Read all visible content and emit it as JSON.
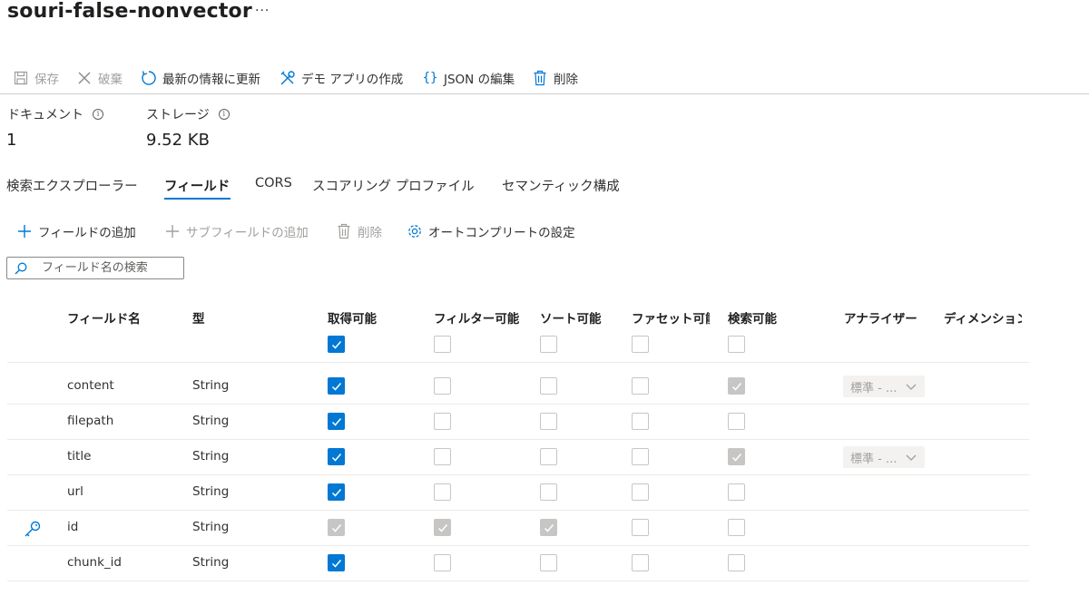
{
  "page": {
    "title": "souri-false-nonvector",
    "more": "···"
  },
  "toolbar": {
    "save": "保存",
    "discard": "破棄",
    "refresh": "最新の情報に更新",
    "demo_app": "デモ アプリの作成",
    "json_edit": "JSON の編集",
    "delete": "削除"
  },
  "stats": {
    "documents_label": "ドキュメント",
    "documents_value": "1",
    "storage_label": "ストレージ",
    "storage_value": "9.52 KB"
  },
  "tabs": [
    "検索エクスプローラー",
    "フィールド",
    "CORS",
    "スコアリング プロファイル",
    "セマンティック構成"
  ],
  "field_toolbar": {
    "add_field": "フィールドの追加",
    "add_subfield": "サブフィールドの追加",
    "delete": "削除",
    "autocomplete": "オートコンプリートの設定"
  },
  "search": {
    "placeholder": "フィールド名の検索"
  },
  "table": {
    "headers": {
      "name": "フィールド名",
      "type": "型",
      "retrievable": "取得可能",
      "filterable": "フィルター可能",
      "sortable": "ソート可能",
      "facetable": "ファセット可能",
      "searchable": "検索可能",
      "analyzer": "アナライザー",
      "dimensions": "ディメンション"
    },
    "header_checks": {
      "retrievable": "on",
      "filterable": "off",
      "sortable": "off",
      "facetable": "off",
      "searchable": "off"
    },
    "rows": [
      {
        "name": "content",
        "type": "String",
        "key": false,
        "retrievable": "on",
        "filterable": "off",
        "sortable": "off",
        "facetable": "off",
        "searchable": "dis",
        "analyzer": "標準 - ..."
      },
      {
        "name": "filepath",
        "type": "String",
        "key": false,
        "retrievable": "on",
        "filterable": "off",
        "sortable": "off",
        "facetable": "off",
        "searchable": "off",
        "analyzer": ""
      },
      {
        "name": "title",
        "type": "String",
        "key": false,
        "retrievable": "on",
        "filterable": "off",
        "sortable": "off",
        "facetable": "off",
        "searchable": "dis",
        "analyzer": "標準 - ..."
      },
      {
        "name": "url",
        "type": "String",
        "key": false,
        "retrievable": "on",
        "filterable": "off",
        "sortable": "off",
        "facetable": "off",
        "searchable": "off",
        "analyzer": ""
      },
      {
        "name": "id",
        "type": "String",
        "key": true,
        "retrievable": "dis",
        "filterable": "dis",
        "sortable": "dis",
        "facetable": "off",
        "searchable": "off",
        "analyzer": ""
      },
      {
        "name": "chunk_id",
        "type": "String",
        "key": false,
        "retrievable": "on",
        "filterable": "off",
        "sortable": "off",
        "facetable": "off",
        "searchable": "off",
        "analyzer": ""
      }
    ]
  },
  "colors": {
    "accent": "#0078d4",
    "disabled_check": "#c8c6c4",
    "disabled_text": "#a19f9d"
  }
}
